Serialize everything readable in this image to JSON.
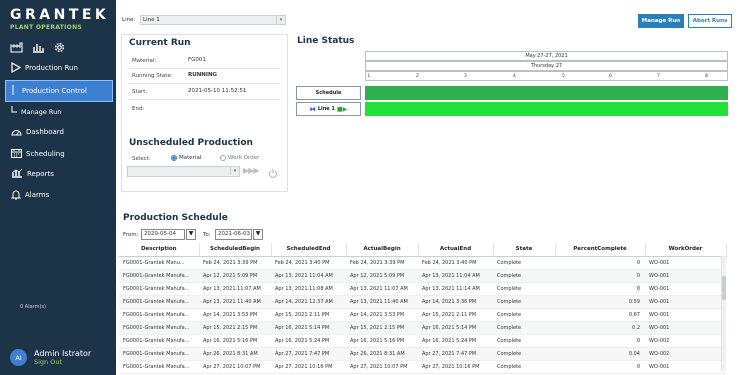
{
  "sidebar": {
    "brand": "GRANTEK",
    "brand_sub": "PLANT OPERATIONS",
    "items": [
      {
        "label": "Production Run",
        "icon": "play-icon"
      },
      {
        "label": "Production Control",
        "icon": "branch-icon"
      },
      {
        "label": "Manage Run",
        "icon": "branch-icon"
      },
      {
        "label": "Dashboard",
        "icon": "gauge-icon"
      },
      {
        "label": "Scheduling",
        "icon": "calendar-icon"
      },
      {
        "label": "Reports",
        "icon": "report-icon"
      },
      {
        "label": "Alarms",
        "icon": "bell-icon"
      }
    ],
    "alarms_count": "0 Alarm(s)",
    "user": {
      "initials": "AI",
      "name": "Admin Istrator",
      "signout": "Sign Out"
    }
  },
  "topbar": {
    "line_label": "Line:",
    "line_value": "Line 1",
    "manage_run": "Manage Run",
    "abort_runs": "Abort Runs"
  },
  "current_run": {
    "title": "Current Run",
    "material_label": "Material:",
    "material_value": "FG001",
    "state_label": "Running State:",
    "state_value": "RUNNING",
    "start_label": "Start:",
    "start_value": "2021-05-10 11:52:51",
    "end_label": "End:",
    "end_value": ""
  },
  "line_status": {
    "title": "Line Status",
    "date_range": "May 27-27, 2021",
    "day": "Thursday 27",
    "ticks": [
      "2",
      "3",
      "4",
      "5",
      "6",
      "7",
      "8"
    ],
    "schedule_label": "Schedule",
    "line_label": "Line 1",
    "colors": {
      "schedule": "#2eb04c",
      "line": "#22e03a"
    }
  },
  "unscheduled": {
    "title": "Unscheduled Production",
    "select_label": "Select:",
    "material": "Material",
    "work_order": "Work Order"
  },
  "schedule": {
    "title": "Production Schedule",
    "from_label": "From:",
    "from_value": "2020-05-04",
    "to_label": "To:",
    "to_value": "2021-06-03",
    "columns": [
      "Description",
      "ScheduledBegin",
      "ScheduledEnd",
      "ActualBegin",
      "ActualEnd",
      "State",
      "PercentComplete",
      "WorkOrder"
    ],
    "rows": [
      [
        "FG0001-Grantek Manu...",
        "Feb 24, 2021 3:39 PM",
        "Feb 24, 2021 3:40 PM",
        "Feb 24, 2021 3:39 PM",
        "Feb 24, 2021 3:40 PM",
        "Complete",
        "0",
        "WO-001"
      ],
      [
        "FG0001-Grantek Manufa...",
        "Apr 12, 2021 5:09 PM",
        "Apr 13, 2021 11:04 AM",
        "Apr 12, 2021 5:09 PM",
        "Apr 13, 2021 11:04 AM",
        "Complete",
        "0",
        "WO-001"
      ],
      [
        "FG0001-Grantek Manufa...",
        "Apr 13, 2021 11:07 AM",
        "Apr 13, 2021 11:08 AM",
        "Apr 13, 2021 11:07 AM",
        "Apr 13, 2021 11:14 AM",
        "Complete",
        "0",
        "WO-001"
      ],
      [
        "FG0001-Grantek Manufa...",
        "Apr 13, 2021 11:40 AM",
        "Apr 14, 2021 12:37 AM",
        "Apr 13, 2021 11:40 AM",
        "Apr 14, 2021 3:36 PM",
        "Complete",
        "0.59",
        "WO-001"
      ],
      [
        "FG0001-Grantek Manufa...",
        "Apr 14, 2021 3:53 PM",
        "Apr 15, 2021 2:11 PM",
        "Apr 14, 2021 3:53 PM",
        "Apr 15, 2021 2:11 PM",
        "Complete",
        "0.67",
        "WO-001"
      ],
      [
        "FG0001-Grantek Manufa...",
        "Apr 15, 2021 2:15 PM",
        "Apr 16, 2021 5:14 PM",
        "Apr 15, 2021 2:15 PM",
        "Apr 16, 2021 5:14 PM",
        "Complete",
        "0.2",
        "WO-001"
      ],
      [
        "FG0001-Grantek Manufa...",
        "Apr 16, 2021 5:16 PM",
        "Apr 16, 2021 5:24 PM",
        "Apr 16, 2021 5:16 PM",
        "Apr 16, 2021 5:24 PM",
        "Complete",
        "0",
        "WO-002"
      ],
      [
        "FG0001-Grantek Manufa...",
        "Apr 26, 2021 8:31 AM",
        "Apr 27, 2021 7:47 PM",
        "Apr 26, 2021 8:31 AM",
        "Apr 27, 2021 7:47 PM",
        "Complete",
        "0.04",
        "WO-002"
      ],
      [
        "FG0001-Grantek Manufa...",
        "Apr 27, 2021 10:07 PM",
        "Apr 27, 2021 10:16 PM",
        "Apr 27, 2021 10:07 PM",
        "Apr 27, 2021 10:16 PM",
        "Complete",
        "0",
        "WO-001"
      ]
    ]
  }
}
